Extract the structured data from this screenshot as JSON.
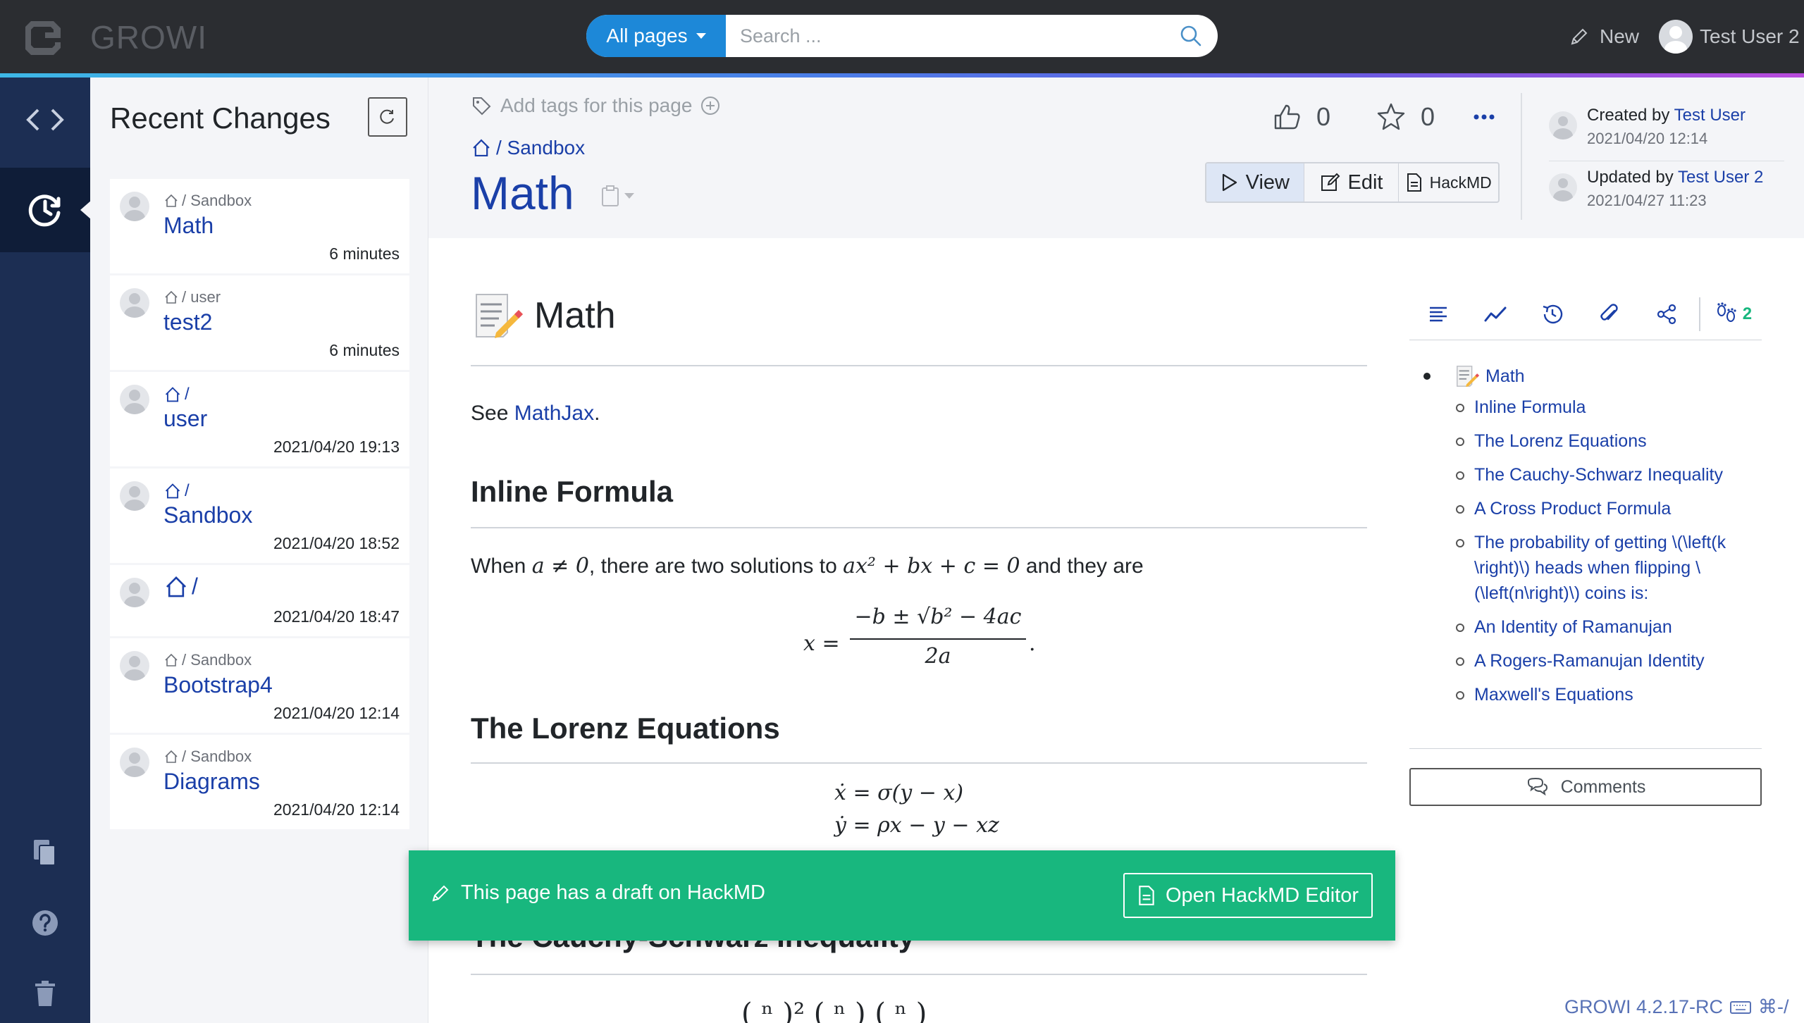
{
  "app": {
    "brand": "GROWI"
  },
  "search": {
    "scope_label": "All pages",
    "placeholder": "Search ..."
  },
  "navbar": {
    "new_label": "New",
    "user_name": "Test User 2"
  },
  "recent_changes": {
    "title": "Recent Changes",
    "items": [
      {
        "path": "/ Sandbox",
        "name": "Math",
        "time": "6 minutes"
      },
      {
        "path": "/ user",
        "name": "test2",
        "time": "6 minutes"
      },
      {
        "path": "/",
        "name": "user",
        "time": "2021/04/20 19:13"
      },
      {
        "path": "/",
        "name": "Sandbox",
        "time": "2021/04/20 18:52"
      },
      {
        "path": "/",
        "name": "",
        "time": "2021/04/20 18:47"
      },
      {
        "path": "/ Sandbox",
        "name": "Bootstrap4",
        "time": "2021/04/20 12:14"
      },
      {
        "path": "/ Sandbox",
        "name": "Diagrams",
        "time": "2021/04/20 12:14"
      }
    ]
  },
  "page": {
    "tags_placeholder": "Add tags for this page",
    "breadcrumb": "/ Sandbox",
    "title": "Math",
    "likes": "0",
    "bookmarks": "0",
    "modes": {
      "view": "View",
      "edit": "Edit",
      "hackmd": "HackMD"
    },
    "created_prefix": "Created by ",
    "created_by": "Test User",
    "created_at": "2021/04/20 12:14",
    "updated_prefix": "Updated by ",
    "updated_by": "Test User 2",
    "updated_at": "2021/04/27 11:23"
  },
  "content": {
    "h1": "Math",
    "see_prefix": "See ",
    "see_link": "MathJax",
    "see_suffix": ".",
    "h2_inline": "Inline Formula",
    "inline_text_1": "When ",
    "inline_math_1": "a ≠ 0",
    "inline_text_2": ", there are two solutions to ",
    "inline_math_2": "ax² + bx + c = 0",
    "inline_text_3": " and they are",
    "formula_lhs": "x =",
    "formula_num": "−b ± √b² − 4ac",
    "formula_den": "2a",
    "h2_lorenz": "The Lorenz Equations",
    "lorenz_1": "ẋ = σ(y − x)",
    "lorenz_2": "ẏ = ρx − y − xz",
    "h2_cauchy": "The Cauchy-Schwarz Inequality"
  },
  "side": {
    "attendees_count": "2",
    "toc_top": "Math",
    "toc_items": [
      "Inline Formula",
      "The Lorenz Equations",
      "The Cauchy-Schwarz Inequality",
      "A Cross Product Formula",
      "The probability of getting \\(\\left(k \\right)\\) heads when flipping \\(\\left(n\\right)\\) coins is:",
      "An Identity of Ramanujan",
      "A Rogers-Ramanujan Identity",
      "Maxwell's Equations"
    ],
    "comments_label": "Comments"
  },
  "draft": {
    "message": "This page has a draft on HackMD",
    "open_label": "Open HackMD Editor"
  },
  "footer": {
    "version": "GROWI 4.2.17-RC",
    "shortcut": "⌘-/"
  },
  "colors": {
    "navbar": "#2b2d31",
    "sidebar": "#1c2e53",
    "accent": "#1d88d8",
    "link": "#1a3fa8",
    "draft": "#18b77e"
  }
}
